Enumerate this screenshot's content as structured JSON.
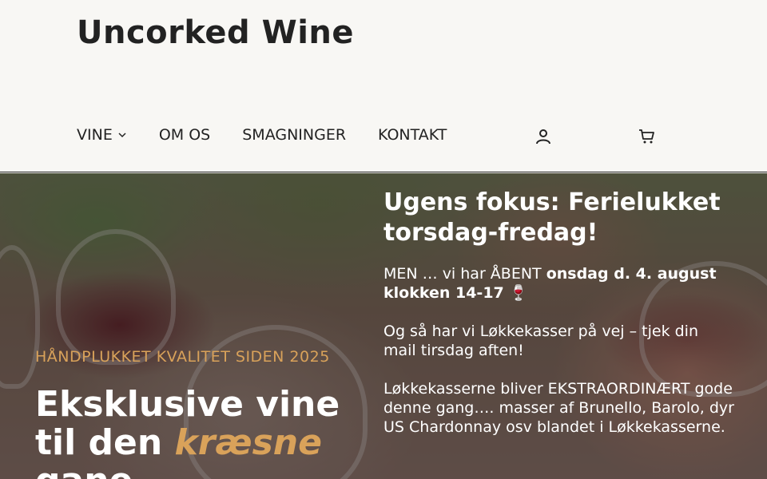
{
  "site": {
    "title": "Uncorked Wine"
  },
  "nav": {
    "items": [
      {
        "label": "VINE",
        "has_dropdown": true
      },
      {
        "label": "OM OS"
      },
      {
        "label": "SMAGNINGER"
      },
      {
        "label": "KONTAKT"
      }
    ],
    "icons": {
      "account": "user-icon",
      "cart": "cart-icon",
      "dropdown": "chevron-down-icon"
    }
  },
  "hero": {
    "tagline": "HÅNDPLUKKET KVALITET SIDEN 2025",
    "headline_pre": "Eksklusive vine til den",
    "headline_accent": "kræsne",
    "headline_post": "gane",
    "accent_color": "#d9a25a"
  },
  "focus": {
    "title": "Ugens fokus: Ferielukket torsdag-fredag!",
    "p1_pre": "MEN … vi har ÅBENT ",
    "p1_bold": "onsdag d. 4. august klokken 14-17 ",
    "p1_emoji": "🍷",
    "p2": "Og så har vi Løkkekasser på vej – tjek din mail tirsdag aften!",
    "p3": "Løkkekasserne bliver EKSTRAORDINÆRT gode denne gang…. masser af Brunello, Barolo, dyr US Chardonnay osv blandet i Løkkekasserne."
  }
}
